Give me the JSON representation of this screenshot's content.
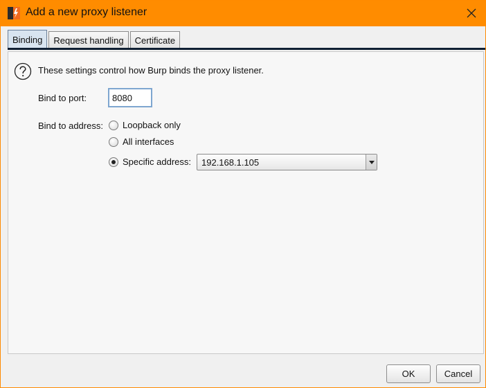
{
  "window": {
    "title": "Add a new proxy listener",
    "accent_color": "#ff8c00"
  },
  "tabs": [
    {
      "label": "Binding",
      "active": true
    },
    {
      "label": "Request handling",
      "active": false
    },
    {
      "label": "Certificate",
      "active": false
    }
  ],
  "binding": {
    "description": "These settings control how Burp binds the proxy listener.",
    "port_label": "Bind to port:",
    "port_value": "8080",
    "address_label": "Bind to address:",
    "address_options": [
      {
        "label": "Loopback only",
        "selected": false
      },
      {
        "label": "All interfaces",
        "selected": false
      },
      {
        "label": "Specific address:",
        "selected": true
      }
    ],
    "specific_address_value": "192.168.1.105"
  },
  "buttons": {
    "ok_label": "OK",
    "cancel_label": "Cancel"
  },
  "icons": {
    "app": "burp-logo-icon",
    "close": "close-icon",
    "help": "help-icon",
    "dropdown": "chevron-down-icon"
  }
}
